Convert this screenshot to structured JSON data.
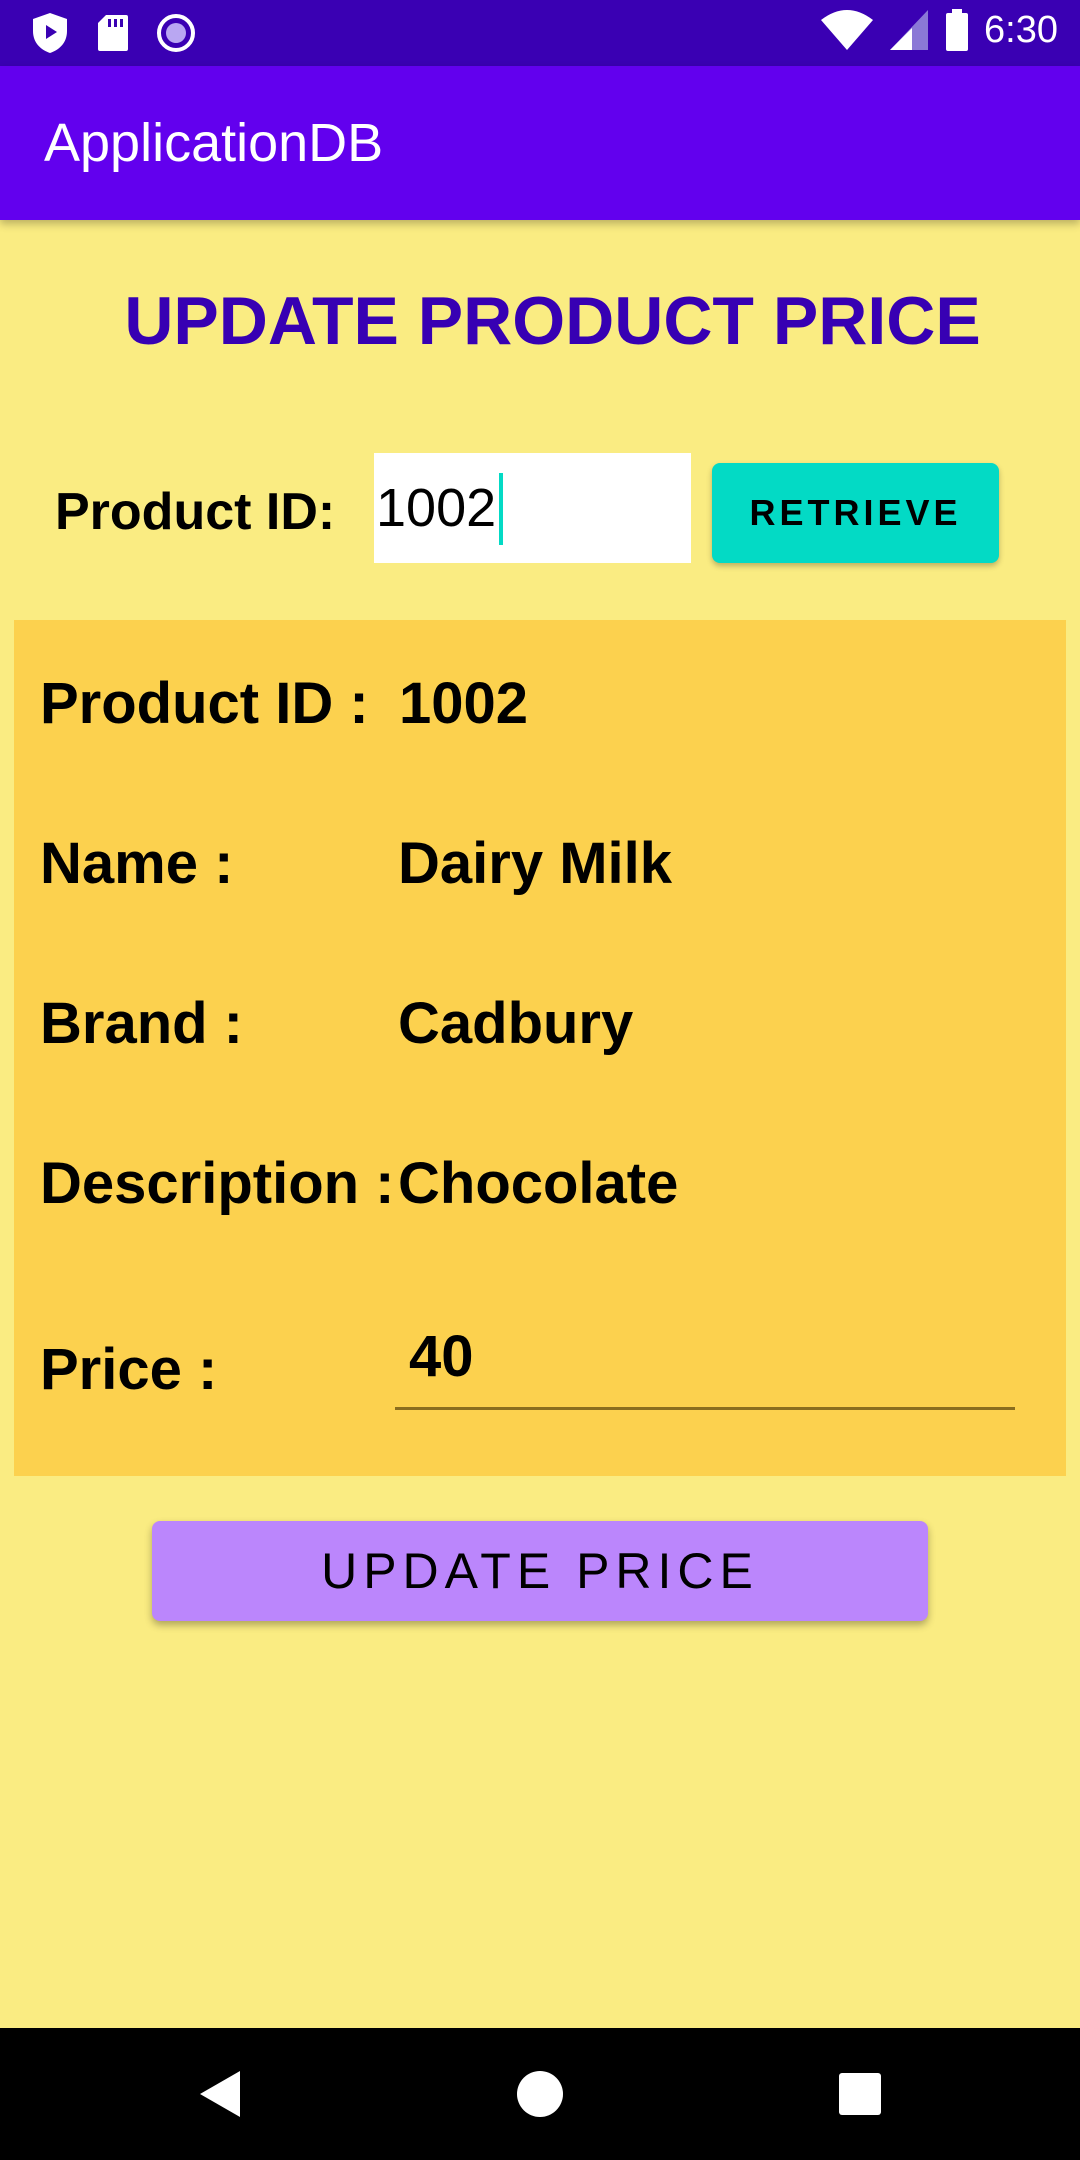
{
  "status_bar": {
    "time": "6:30",
    "icons": [
      "shield-icon",
      "sd-card-icon",
      "record-icon",
      "wifi-icon",
      "signal-icon",
      "battery-icon"
    ]
  },
  "app_bar": {
    "title": "ApplicationDB"
  },
  "page": {
    "heading": "UPDATE PRODUCT PRICE"
  },
  "lookup": {
    "label": "Product ID:",
    "input_value": "1002",
    "retrieve_label": "RETRIEVE"
  },
  "details": {
    "product_id_label": "Product ID :",
    "product_id_value": "1002",
    "name_label": "Name :",
    "name_value": "Dairy Milk",
    "brand_label": "Brand :",
    "brand_value": "Cadbury",
    "description_label": "Description :",
    "description_value": "Chocolate",
    "price_label": "Price :",
    "price_value": "40"
  },
  "actions": {
    "update_label": "UPDATE PRICE"
  },
  "nav": {
    "icons": [
      "back-icon",
      "home-icon",
      "recents-icon"
    ]
  },
  "colors": {
    "status_bar": "#3A00B3",
    "app_bar": "#6200EE",
    "background": "#FAEC82",
    "card": "#FCD14E",
    "accent": "#03DAC5",
    "button": "#BB86FC",
    "heading": "#3700B3"
  }
}
